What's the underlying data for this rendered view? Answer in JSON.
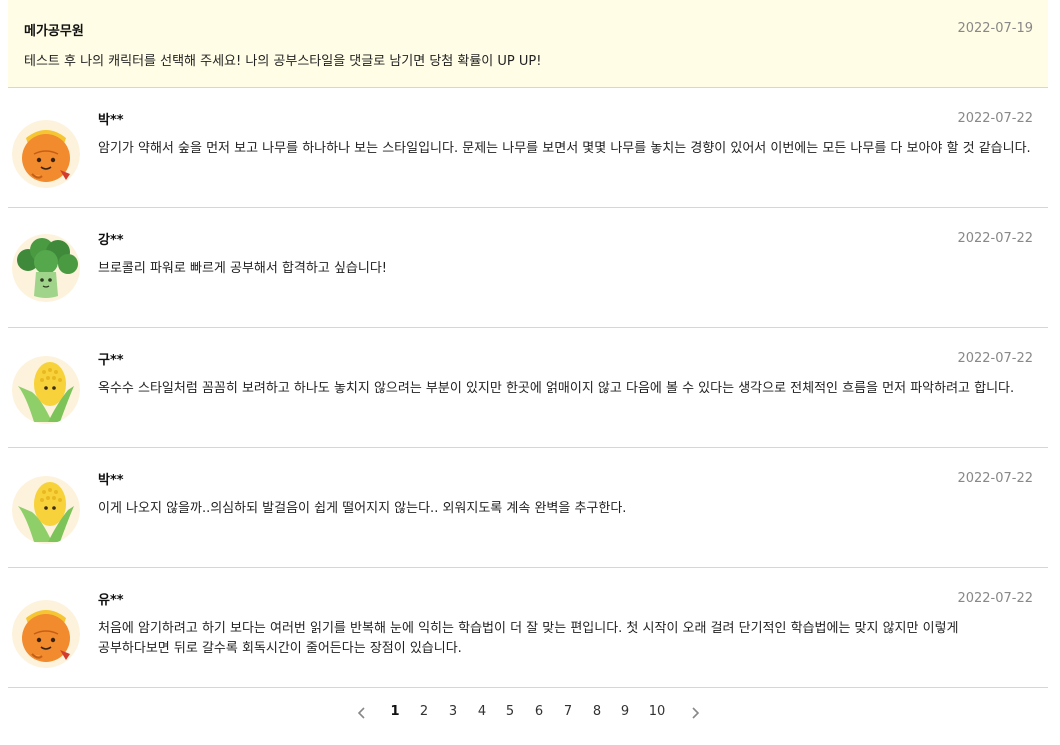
{
  "notice": {
    "author": "메가공무원",
    "date": "2022-07-19",
    "text": "테스트 후 나의 캐릭터를 선택해 주세요! 나의 공부스타일을 댓글로 남기면 당첨 확률이 UP UP!"
  },
  "comments": [
    {
      "author": "박**",
      "date": "2022-07-22",
      "avatar": "tangerine-character-icon",
      "text": "암기가 약해서 숲을 먼저 보고 나무를 하나하나 보는 스타일입니다. 문제는 나무를 보면서 몇몇 나무를 놓치는 경향이 있어서 이번에는 모든 나무를 다 보아야 할 것 같습니다."
    },
    {
      "author": "강**",
      "date": "2022-07-22",
      "avatar": "broccoli-character-icon",
      "text": "브로콜리 파워로 빠르게 공부해서 합격하고 싶습니다!"
    },
    {
      "author": "구**",
      "date": "2022-07-22",
      "avatar": "corn-character-icon",
      "text": "옥수수 스타일처럼 꼼꼼히 보려하고 하나도 놓치지 않으려는 부분이 있지만 한곳에 얽매이지 않고 다음에 볼 수 있다는 생각으로 전체적인 흐름을 먼저 파악하려고 합니다."
    },
    {
      "author": "박**",
      "date": "2022-07-22",
      "avatar": "corn-character-icon",
      "text": "이게 나오지 않을까..의심하되 발걸음이 쉽게 떨어지지 않는다.. 외워지도록 계속 완벽을 추구한다."
    },
    {
      "author": "유**",
      "date": "2022-07-22",
      "avatar": "tangerine-character-icon",
      "text": "처음에 암기하려고 하기 보다는 여러번 읽기를 반복해 눈에 익히는 학습법이 더 잘 맞는 편입니다. 첫 시작이 오래 걸려 단기적인 학습법에는 맞지 않지만 이렇게 공부하다보면 뒤로 갈수록 회독시간이 줄어든다는 장점이 있습니다."
    }
  ],
  "pagination": {
    "current": "1",
    "pages": [
      "1",
      "2",
      "3",
      "4",
      "5",
      "6",
      "7",
      "8",
      "9",
      "10"
    ]
  },
  "colors": {
    "notice_bg": "#fffde6",
    "divider": "#d6d6d6",
    "date": "#888888",
    "tangerine": "#f28a2e",
    "broccoli": "#3f8a3a",
    "corn": "#f7d23a"
  }
}
